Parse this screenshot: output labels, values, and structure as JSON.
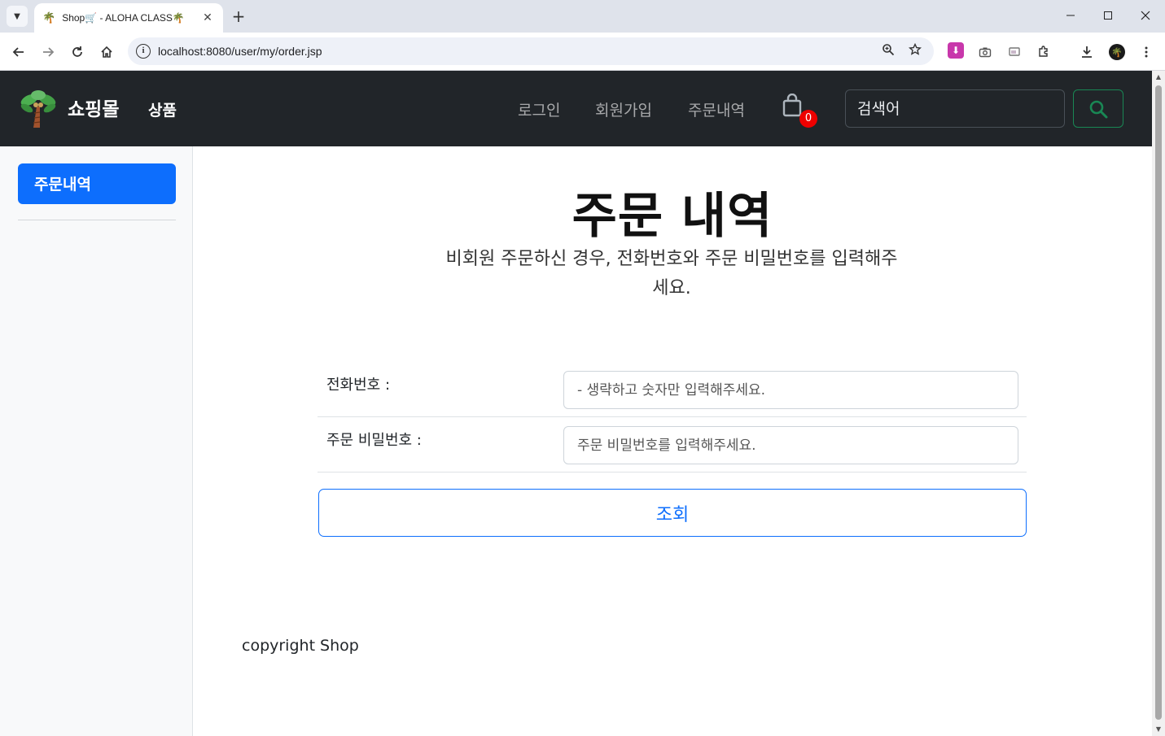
{
  "browser": {
    "tab_title": "Shop🛒 - ALOHA CLASS🌴",
    "url": "localhost:8080/user/my/order.jsp",
    "new_tab_symbol": "+",
    "tab_close_symbol": "✕"
  },
  "navbar": {
    "brand": "쇼핑몰",
    "products": "상품",
    "links": [
      "로그인",
      "회원가입",
      "주문내역"
    ],
    "cart_count": "0",
    "search_placeholder": "검색어"
  },
  "sidebar": {
    "items": [
      {
        "label": "주문내역",
        "active": true
      }
    ]
  },
  "main": {
    "title": "주문 내역",
    "subtitle": "비회원 주문하신 경우, 전화번호와 주문 비밀번호를 입력해주세요.",
    "phone_label": "전화번호 :",
    "phone_placeholder": "- 생략하고 숫자만 입력해주세요.",
    "password_label": "주문 비밀번호 :",
    "password_placeholder": "주문 비밀번호를 입력해주세요.",
    "submit_label": "조회"
  },
  "footer": {
    "text": "copyright Shop"
  },
  "colors": {
    "navbar_bg": "#212529",
    "primary": "#0d6efd",
    "success": "#198754",
    "badge": "#e00000"
  }
}
